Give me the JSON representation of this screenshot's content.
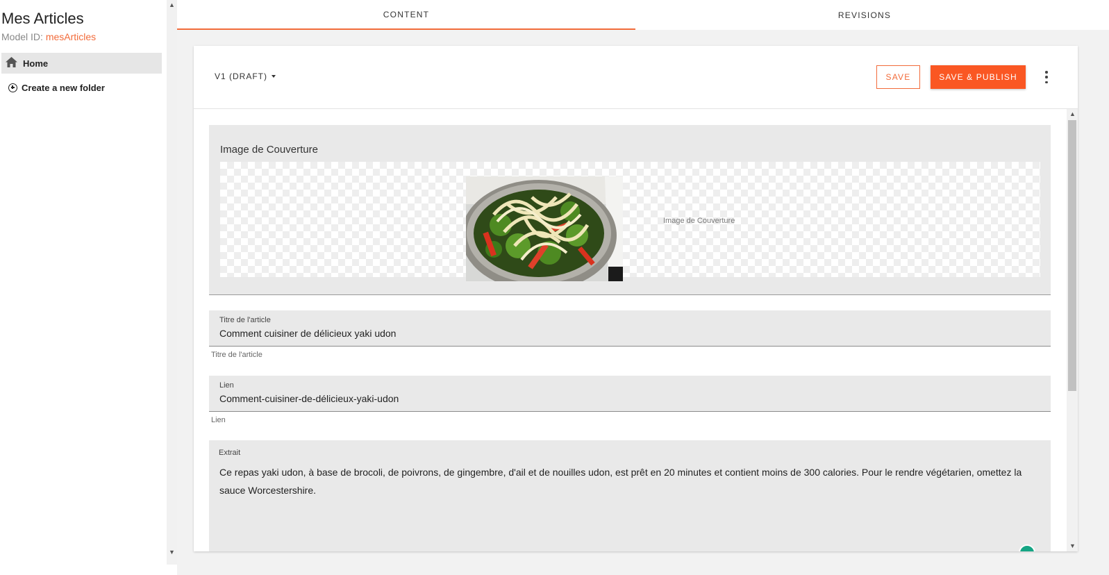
{
  "app": {
    "title": "Mes Articles",
    "model_id_label": "Model ID:",
    "model_id_value": "mesArticles"
  },
  "sidebar": {
    "items": [
      {
        "label": "Home",
        "icon": "home-icon",
        "active": true
      },
      {
        "label": "Create a new folder",
        "icon": "add-circle-icon"
      }
    ]
  },
  "tabs": [
    {
      "label": "CONTENT",
      "active": true
    },
    {
      "label": "REVISIONS",
      "active": false
    }
  ],
  "toolbar": {
    "version_label": "V1 (DRAFT)",
    "save_label": "SAVE",
    "publish_label": "SAVE & PUBLISH",
    "more_icon": "more-vertical-icon"
  },
  "form": {
    "cover_image": {
      "label": "Image de Couverture",
      "caption": "Image de Couverture"
    },
    "title": {
      "label": "Titre de l'article",
      "value": "Comment cuisiner de délicieux yaki udon",
      "helper": "Titre de l'article"
    },
    "link": {
      "label": "Lien",
      "value": "Comment-cuisiner-de-délicieux-yaki-udon",
      "helper": "Lien"
    },
    "excerpt": {
      "label": "Extrait",
      "value": "Ce repas yaki udon, à base de brocoli, de poivrons, de gingembre, d'ail et de nouilles udon, est prêt en 20 minutes et contient moins de 300 calories. Pour le rendre végétarien, omettez la sauce Worcestershire."
    }
  },
  "colors": {
    "accent": "#fa5723",
    "accent_text": "#f26b3a",
    "field_bg": "#e9e9e9"
  }
}
